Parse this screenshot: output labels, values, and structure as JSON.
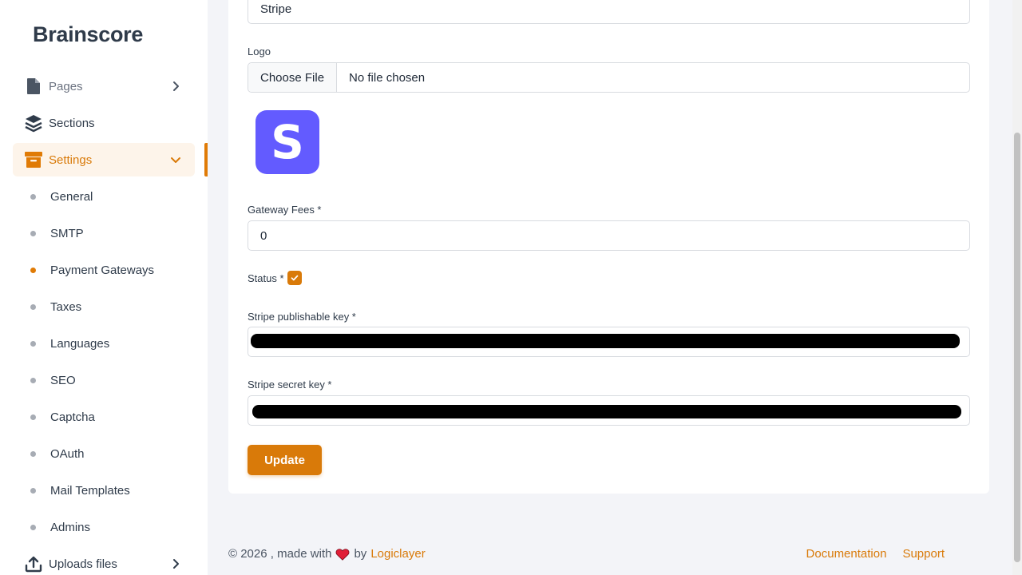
{
  "brand": "Brainscore",
  "nav": {
    "pages": "Pages",
    "sections": "Sections",
    "settings": "Settings",
    "uploads": "Uploads files"
  },
  "settings_items": [
    "General",
    "SMTP",
    "Payment Gateways",
    "Taxes",
    "Languages",
    "SEO",
    "Captcha",
    "OAuth",
    "Mail Templates",
    "Admins"
  ],
  "current_settings_item": "Payment Gateways",
  "form": {
    "name_value": "Stripe",
    "logo_label": "Logo",
    "choose_file": "Choose File",
    "no_file": "No file chosen",
    "logo_letter": "S",
    "fees_label": "Gateway Fees *",
    "fees_value": "0",
    "status_label": "Status *",
    "status_checked": true,
    "publishable_label": "Stripe publishable key *",
    "secret_label": "Stripe secret key *",
    "update_label": "Update"
  },
  "footer": {
    "copyright": "© 2026 , made with",
    "by": "by",
    "company": "Logiclayer",
    "documentation": "Documentation",
    "support": "Support"
  },
  "colors": {
    "accent": "#d97a09",
    "stripe_purple": "#635bff"
  }
}
